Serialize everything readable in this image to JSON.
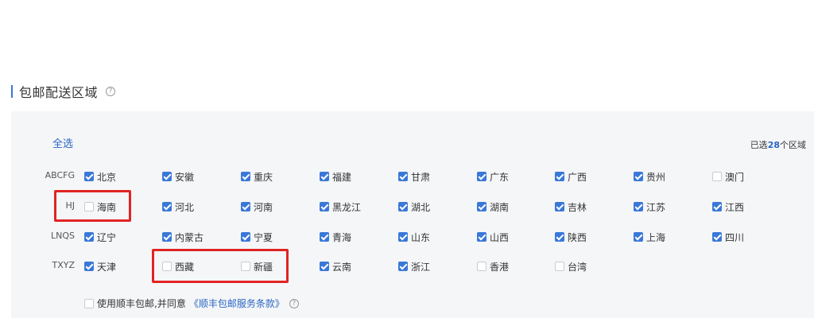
{
  "section": {
    "title": "包邮配送区域",
    "help_icon": "?"
  },
  "select_all": "全选",
  "selected": {
    "prefix": "已选",
    "count": "28",
    "suffix": "个区域"
  },
  "groups": [
    {
      "label": "ABCFG"
    },
    {
      "label": "HJ"
    },
    {
      "label": "LNQS"
    },
    {
      "label": "TXYZ"
    }
  ],
  "regions": [
    {
      "name": "北京",
      "checked": true
    },
    {
      "name": "安徽",
      "checked": true
    },
    {
      "name": "重庆",
      "checked": true
    },
    {
      "name": "福建",
      "checked": true
    },
    {
      "name": "甘肃",
      "checked": true
    },
    {
      "name": "广东",
      "checked": true
    },
    {
      "name": "广西",
      "checked": true
    },
    {
      "name": "贵州",
      "checked": true
    },
    {
      "name": "澳门",
      "checked": false
    },
    {
      "name": "海南",
      "checked": false
    },
    {
      "name": "河北",
      "checked": true
    },
    {
      "name": "河南",
      "checked": true
    },
    {
      "name": "黑龙江",
      "checked": true
    },
    {
      "name": "湖北",
      "checked": true
    },
    {
      "name": "湖南",
      "checked": true
    },
    {
      "name": "吉林",
      "checked": true
    },
    {
      "name": "江苏",
      "checked": true
    },
    {
      "name": "江西",
      "checked": true
    },
    {
      "name": "辽宁",
      "checked": true
    },
    {
      "name": "内蒙古",
      "checked": true
    },
    {
      "name": "宁夏",
      "checked": true
    },
    {
      "name": "青海",
      "checked": true
    },
    {
      "name": "山东",
      "checked": true
    },
    {
      "name": "山西",
      "checked": true
    },
    {
      "name": "陕西",
      "checked": true
    },
    {
      "name": "上海",
      "checked": true
    },
    {
      "name": "四川",
      "checked": true
    },
    {
      "name": "天津",
      "checked": true
    },
    {
      "name": "西藏",
      "checked": false
    },
    {
      "name": "新疆",
      "checked": false
    },
    {
      "name": "云南",
      "checked": true
    },
    {
      "name": "浙江",
      "checked": true
    },
    {
      "name": "香港",
      "checked": false
    },
    {
      "name": "台湾",
      "checked": false
    }
  ],
  "agreement": {
    "checked": false,
    "text": "使用顺丰包邮,并同意",
    "link": "《顺丰包邮服务条款》",
    "help_icon": "?"
  },
  "colors": {
    "accent": "#3a78d8",
    "highlight": "#e02424",
    "panel": "#f5f6f8"
  }
}
